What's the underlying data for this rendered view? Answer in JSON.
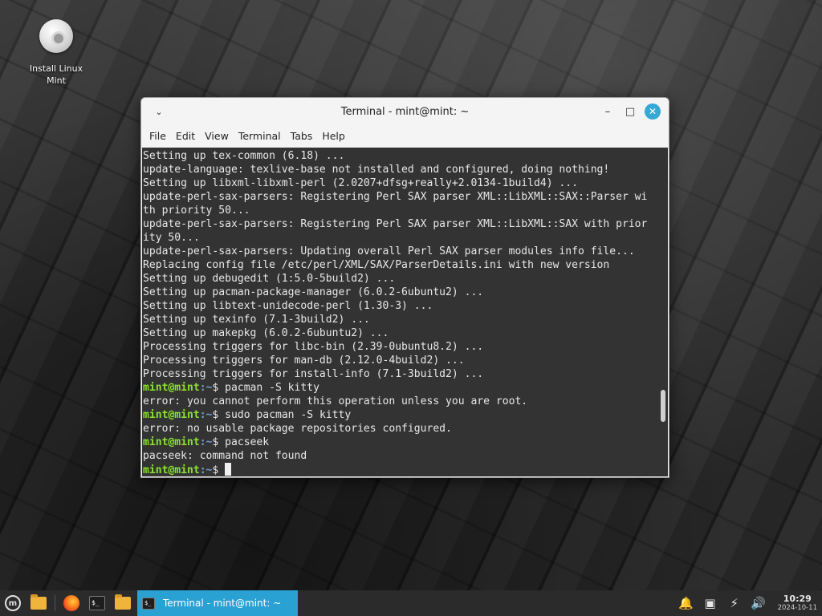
{
  "desktop": {
    "icons": [
      {
        "label": "Install Linux Mint"
      }
    ]
  },
  "window": {
    "title": "Terminal - mint@mint: ~",
    "menu": [
      "File",
      "Edit",
      "View",
      "Terminal",
      "Tabs",
      "Help"
    ]
  },
  "terminal": {
    "prompt_user": "mint@mint",
    "prompt_path": ":~",
    "prompt_symbol": "$",
    "lines": [
      {
        "type": "out",
        "text": "Setting up tex-common (6.18) ..."
      },
      {
        "type": "out",
        "text": "update-language: texlive-base not installed and configured, doing nothing!"
      },
      {
        "type": "out",
        "text": "Setting up libxml-libxml-perl (2.0207+dfsg+really+2.0134-1build4) ..."
      },
      {
        "type": "out",
        "text": "update-perl-sax-parsers: Registering Perl SAX parser XML::LibXML::SAX::Parser wi"
      },
      {
        "type": "out",
        "text": "th priority 50..."
      },
      {
        "type": "out",
        "text": "update-perl-sax-parsers: Registering Perl SAX parser XML::LibXML::SAX with prior"
      },
      {
        "type": "out",
        "text": "ity 50..."
      },
      {
        "type": "out",
        "text": "update-perl-sax-parsers: Updating overall Perl SAX parser modules info file..."
      },
      {
        "type": "out",
        "text": "Replacing config file /etc/perl/XML/SAX/ParserDetails.ini with new version"
      },
      {
        "type": "out",
        "text": "Setting up debugedit (1:5.0-5build2) ..."
      },
      {
        "type": "out",
        "text": "Setting up pacman-package-manager (6.0.2-6ubuntu2) ..."
      },
      {
        "type": "out",
        "text": "Setting up libtext-unidecode-perl (1.30-3) ..."
      },
      {
        "type": "out",
        "text": "Setting up texinfo (7.1-3build2) ..."
      },
      {
        "type": "out",
        "text": "Setting up makepkg (6.0.2-6ubuntu2) ..."
      },
      {
        "type": "out",
        "text": "Processing triggers for libc-bin (2.39-0ubuntu8.2) ..."
      },
      {
        "type": "out",
        "text": "Processing triggers for man-db (2.12.0-4build2) ..."
      },
      {
        "type": "out",
        "text": "Processing triggers for install-info (7.1-3build2) ..."
      },
      {
        "type": "cmd",
        "text": " pacman -S kitty"
      },
      {
        "type": "out",
        "text": "error: you cannot perform this operation unless you are root."
      },
      {
        "type": "cmd",
        "text": " sudo pacman -S kitty"
      },
      {
        "type": "out",
        "text": "error: no usable package repositories configured."
      },
      {
        "type": "cmd",
        "text": " pacseek"
      },
      {
        "type": "out",
        "text": "pacseek: command not found"
      },
      {
        "type": "cursor",
        "text": " "
      }
    ]
  },
  "taskbar": {
    "launchers": [
      {
        "name": "mint-menu-icon"
      },
      {
        "name": "files-icon"
      },
      {
        "name": "firefox-icon"
      },
      {
        "name": "terminal-icon"
      },
      {
        "name": "folder-icon"
      }
    ],
    "active_task": "Terminal - mint@mint: ~",
    "clock": {
      "time": "10:29",
      "date": "2024-10-11"
    }
  },
  "colors": {
    "accent": "#2aa1d3",
    "prompt_user": "#8ae234",
    "prompt_path": "#729fcf",
    "terminal_bg": "#333333"
  }
}
